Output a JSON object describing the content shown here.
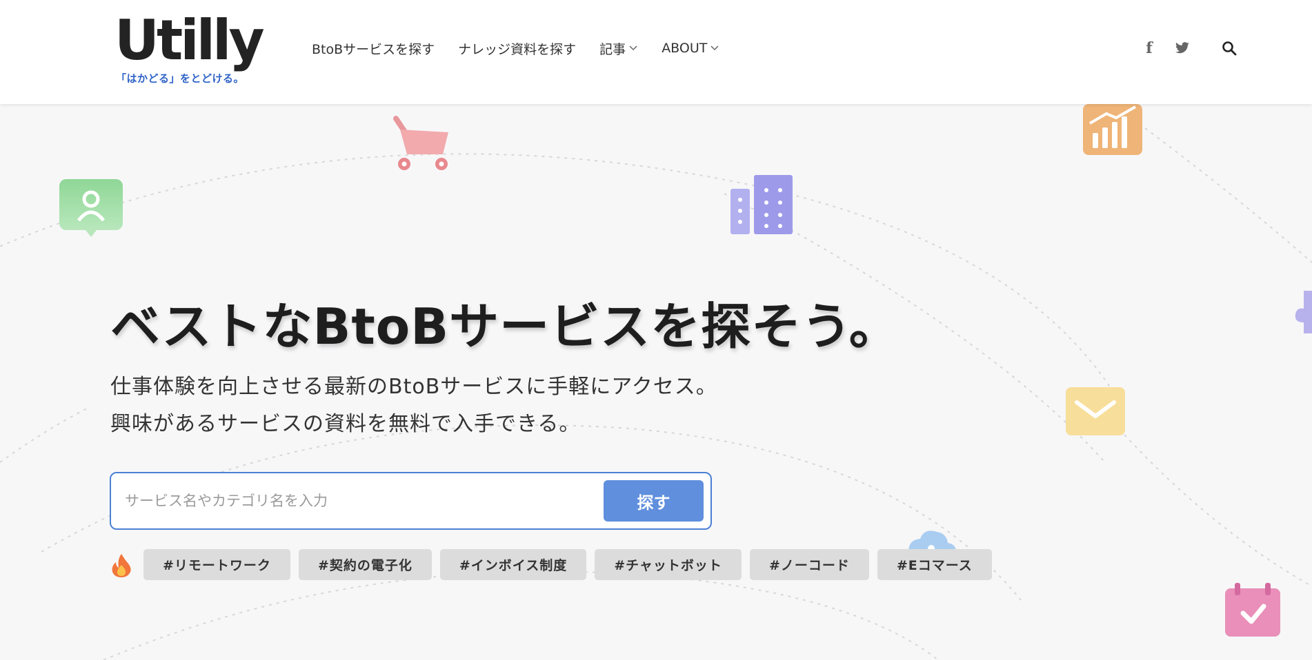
{
  "header": {
    "logo_text": "Utilly",
    "logo_tagline": "「はかどる」をとどける。",
    "nav": [
      {
        "label": "BtoBサービスを探す",
        "dropdown": false
      },
      {
        "label": "ナレッジ資料を探す",
        "dropdown": false
      },
      {
        "label": "記事",
        "dropdown": true
      },
      {
        "label": "ABOUT",
        "dropdown": true
      }
    ],
    "icons": [
      "facebook-icon",
      "twitter-icon",
      "search-icon"
    ]
  },
  "hero": {
    "title": "ベストなBtoBサービスを探そう。",
    "subtitle_line1": "仕事体験を向上させる最新のBtoBサービスに手軽にアクセス。",
    "subtitle_line2": "興味があるサービスの資料を無料で入手できる。"
  },
  "search": {
    "placeholder": "サービス名やカテゴリ名を入力",
    "button_label": "探す"
  },
  "popular_tags": {
    "icon": "fire-icon",
    "tags": [
      "#リモートワーク",
      "#契約の電子化",
      "#インボイス制度",
      "#チャットボット",
      "#ノーコード",
      "#Eコマース"
    ]
  },
  "decorations": [
    "user-bubble-icon",
    "shopping-cart-icon",
    "building-icon",
    "chart-growth-icon",
    "puzzle-icon",
    "mail-icon",
    "cloud-icon",
    "calendar-check-icon"
  ],
  "colors": {
    "accent": "#5f8fdd",
    "search_border": "#4a7fd4",
    "tagline": "#2f63c7",
    "tag_bg": "#dcdcdc",
    "page_bg": "#f7f7f8"
  }
}
